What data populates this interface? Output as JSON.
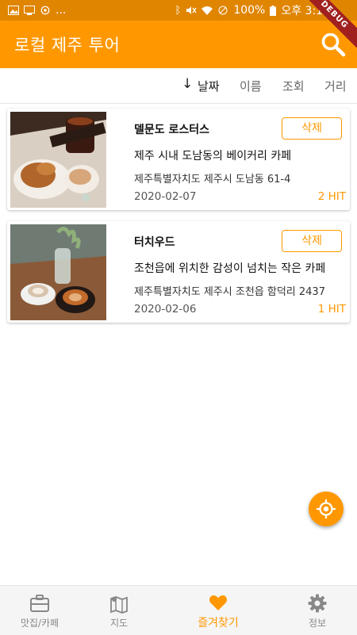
{
  "status_bar": {
    "left_icons": [
      "image-icon",
      "cast-icon",
      "sync-icon"
    ],
    "left_more": "...",
    "battery": "100%",
    "clock": "오후 3:17",
    "right_icons": [
      "bluetooth-icon",
      "mute-icon",
      "wifi-icon",
      "no-sim-icon",
      "battery-icon"
    ]
  },
  "app_bar": {
    "title": "로컬 제주 투어",
    "search_icon": "search-icon",
    "debug_label": "DEBUG"
  },
  "sort_bar": {
    "arrow": "↓",
    "options": [
      "날짜",
      "이름",
      "조회",
      "거리"
    ],
    "active": "날짜"
  },
  "favorites": [
    {
      "name": "델문도 로스터스",
      "description": "제주 시내 도남동의 베이커리 카페",
      "address": "제주특별자치도 제주시 도남동 61-4",
      "date": "2020-02-07",
      "hits": "2 HIT",
      "delete_label": "삭제"
    },
    {
      "name": "터치우드",
      "description": "조천읍에 위치한 감성이 넘치는 작은 카페",
      "address": "제주특별자치도 제주시 조천읍 함덕리 2437",
      "date": "2020-02-06",
      "hits": "1 HIT",
      "delete_label": "삭제"
    }
  ],
  "fab": {
    "icon": "gps-fixed-icon"
  },
  "bottom_nav": [
    {
      "label": "맛집/카페",
      "icon": "briefcase-icon",
      "active": false
    },
    {
      "label": "지도",
      "icon": "map-icon",
      "active": false
    },
    {
      "label": "즐겨찾기",
      "icon": "heart-icon",
      "active": true
    },
    {
      "label": "정보",
      "icon": "gear-icon",
      "active": false
    }
  ],
  "colors": {
    "status_bar": "#e08500",
    "primary": "#ff9800",
    "debug_ribbon": "#a02020",
    "inactive_nav": "#888888"
  }
}
